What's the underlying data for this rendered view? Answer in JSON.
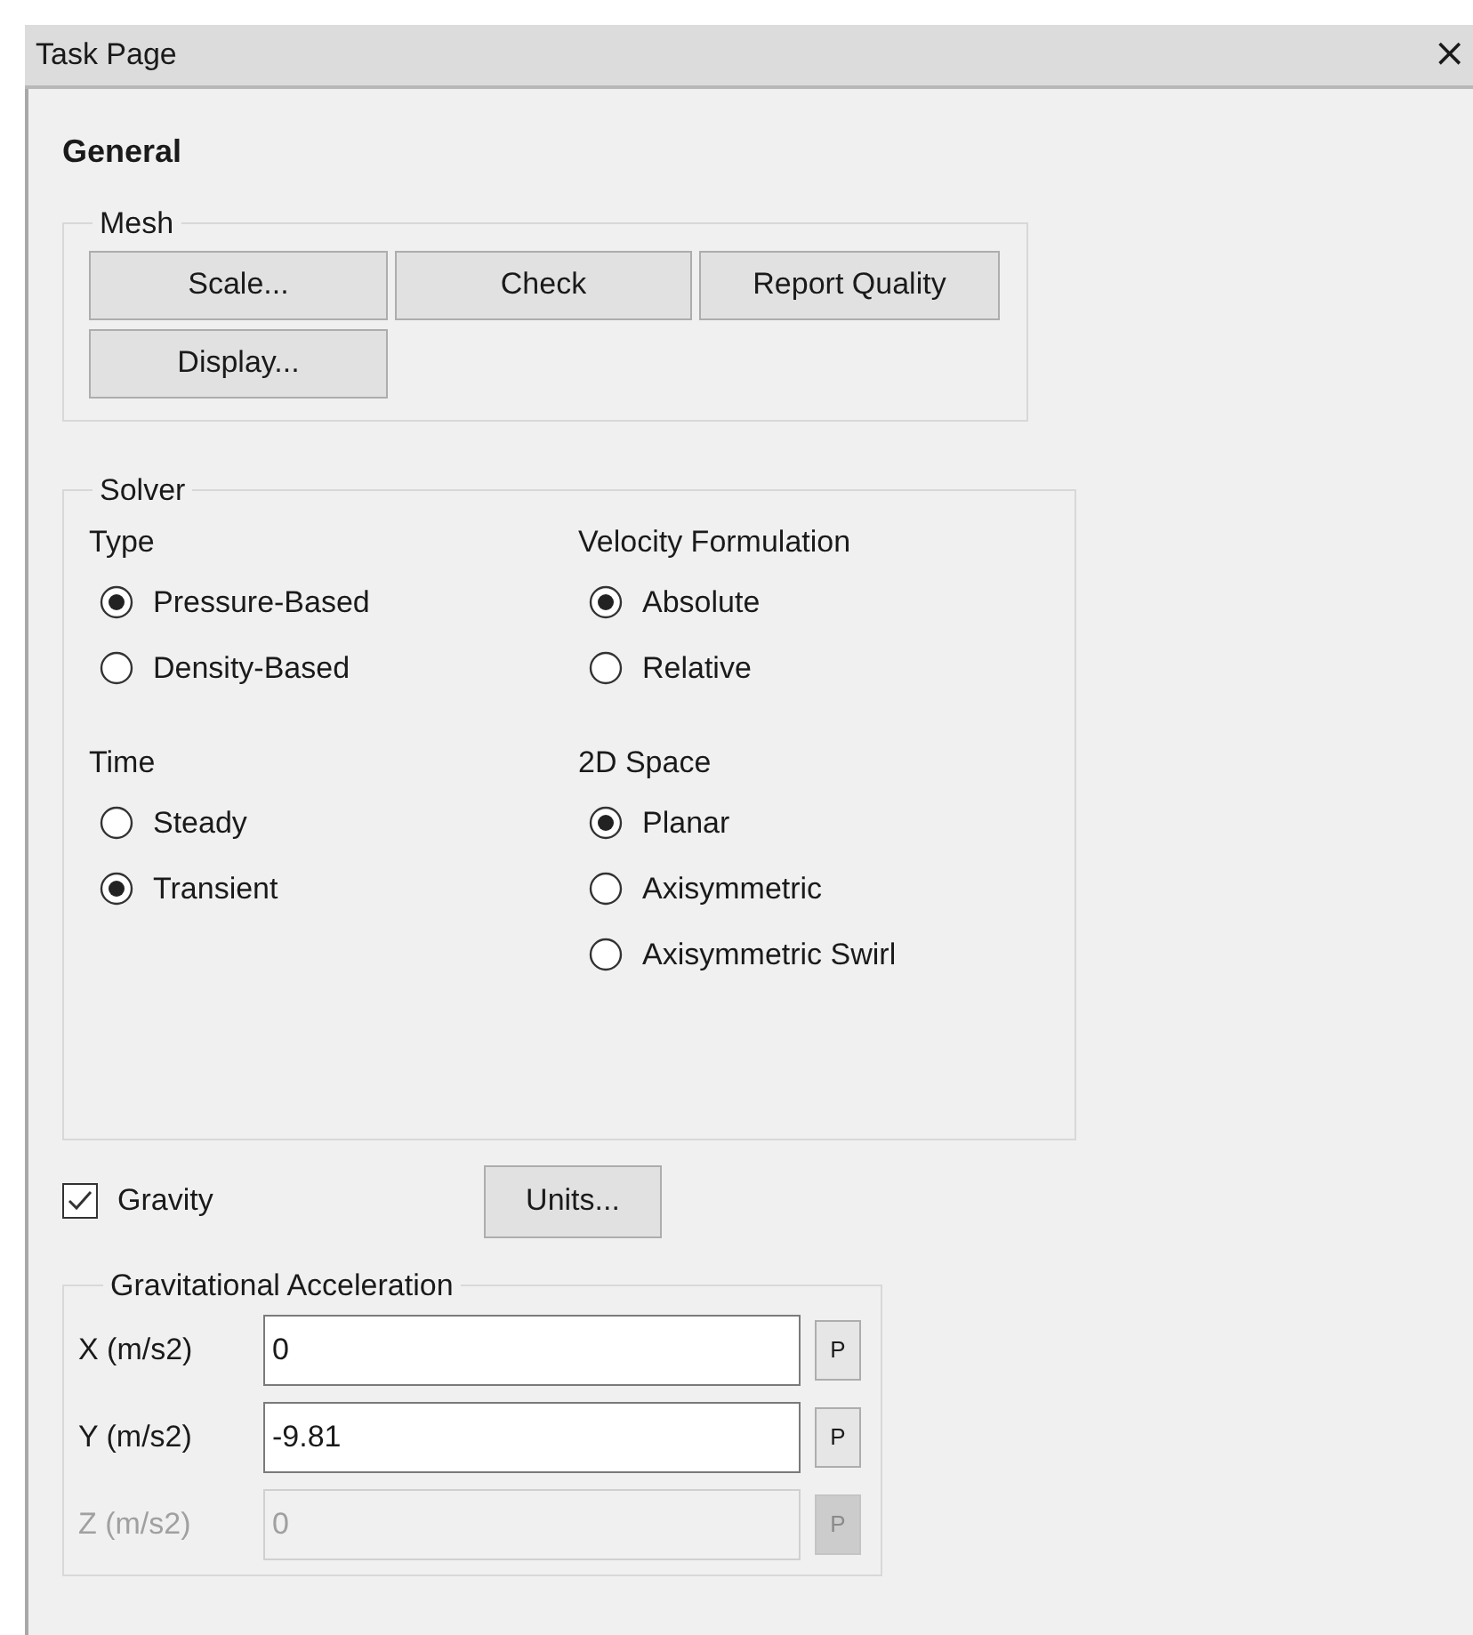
{
  "window": {
    "title": "Task Page",
    "close": "×"
  },
  "heading": "General",
  "mesh": {
    "title": "Mesh",
    "buttons": [
      "Scale...",
      "Check",
      "Report Quality",
      "Display..."
    ]
  },
  "solver": {
    "title": "Solver",
    "groups": [
      {
        "label": "Type",
        "options": [
          {
            "label": "Pressure-Based",
            "selected": true
          },
          {
            "label": "Density-Based",
            "selected": false
          }
        ]
      },
      {
        "label": "Velocity Formulation",
        "options": [
          {
            "label": "Absolute",
            "selected": true
          },
          {
            "label": "Relative",
            "selected": false
          }
        ]
      },
      {
        "label": "Time",
        "options": [
          {
            "label": "Steady",
            "selected": false
          },
          {
            "label": "Transient",
            "selected": true
          }
        ]
      },
      {
        "label": "2D Space",
        "options": [
          {
            "label": "Planar",
            "selected": true
          },
          {
            "label": "Axisymmetric",
            "selected": false
          },
          {
            "label": "Axisymmetric Swirl",
            "selected": false
          }
        ]
      }
    ]
  },
  "gravity": {
    "label": "Gravity",
    "checked": true
  },
  "units_button": "Units...",
  "gravitational_acceleration": {
    "title": "Gravitational Acceleration",
    "fields": [
      {
        "label": "X (m/s2)",
        "value": "0",
        "disabled": false,
        "parameter_button": "P"
      },
      {
        "label": "Y (m/s2)",
        "value": "-9.81",
        "disabled": false,
        "parameter_button": "P"
      },
      {
        "label": "Z (m/s2)",
        "value": "0",
        "disabled": true,
        "parameter_button": "P"
      }
    ]
  }
}
